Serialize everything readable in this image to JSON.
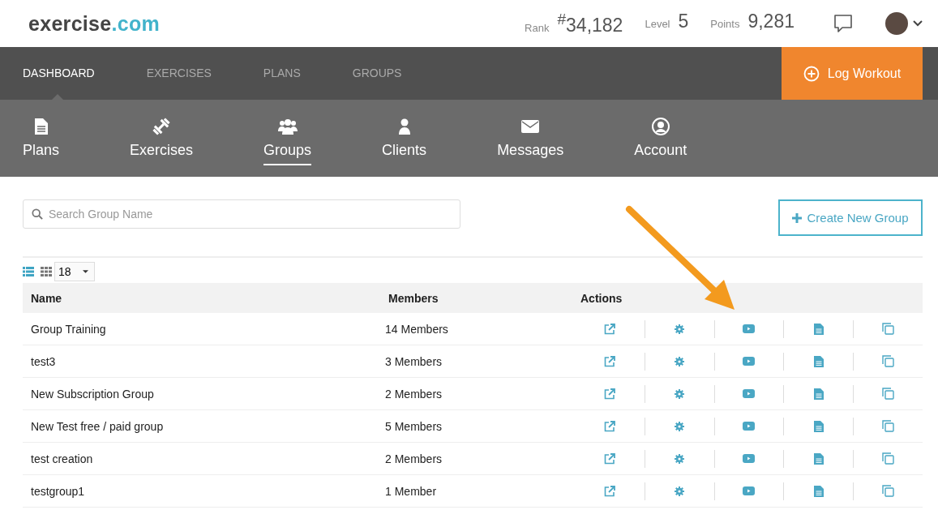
{
  "logo": {
    "name": "exercise",
    "suffix": ".com"
  },
  "stats": [
    {
      "label": "Rank",
      "value": "$^{#}$34,182"
    },
    {
      "label": "Level",
      "value": "5"
    },
    {
      "label": "Points",
      "value": "9,281"
    }
  ],
  "main_nav": [
    {
      "label": "DASHBOARD",
      "selected": true
    },
    {
      "label": "EXERCISES",
      "selected": false
    },
    {
      "label": "PLANS",
      "selected": false
    },
    {
      "label": "GROUPS",
      "selected": false
    }
  ],
  "log_button": "Log Workout",
  "sub_nav": [
    {
      "label": "Plans",
      "kind": "file",
      "selected": false
    },
    {
      "label": "Exercises",
      "kind": "dumbbell",
      "selected": false
    },
    {
      "label": "Groups",
      "kind": "users",
      "selected": true
    },
    {
      "label": "Clients",
      "kind": "user",
      "selected": false
    },
    {
      "label": "Messages",
      "kind": "envelope",
      "selected": false
    },
    {
      "label": "Account",
      "kind": "account",
      "selected": false
    }
  ],
  "search": {
    "placeholder": "Search Group Name"
  },
  "create_button": "Create New Group",
  "views": [
    {
      "kind": "list",
      "selected": true
    },
    {
      "kind": "grid",
      "selected": false
    }
  ],
  "page_size": "18",
  "table": {
    "columns": [
      "Name",
      "Members",
      "Actions"
    ],
    "rows": [
      {
        "name": "Group Training",
        "members": "14 Members"
      },
      {
        "name": "test3",
        "members": "3 Members"
      },
      {
        "name": "New Subscription Group",
        "members": "2 Members"
      },
      {
        "name": "New Test free / paid group",
        "members": "5 Members"
      },
      {
        "name": "test creation",
        "members": "2 Members"
      },
      {
        "name": "testgroup1",
        "members": "1 Member"
      }
    ]
  }
}
